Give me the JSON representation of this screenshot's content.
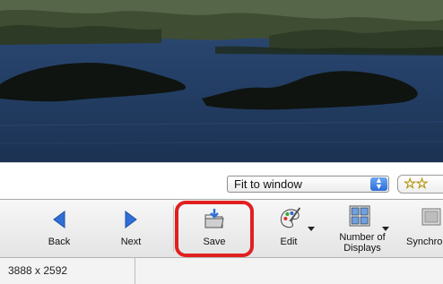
{
  "viewer": {
    "zoom_select": {
      "value": "Fit to window"
    },
    "rating": {
      "stars": "☆☆"
    }
  },
  "toolbar": {
    "back_label": "Back",
    "next_label": "Next",
    "save_label": "Save",
    "edit_label": "Edit",
    "displays_label_line1": "Number of",
    "displays_label_line2": "Displays",
    "sync_label": "Synchro"
  },
  "status": {
    "dimensions": "3888 x 2592"
  },
  "icons": {
    "back": "back-arrow-icon",
    "next": "next-arrow-icon",
    "save": "save-folder-icon",
    "edit": "edit-palette-icon",
    "displays": "multi-display-icon",
    "sync": "sync-icon"
  },
  "colors": {
    "accent_blue": "#2f6fd6",
    "highlight_red": "#e02020",
    "star_yellow": "#e7c400"
  }
}
